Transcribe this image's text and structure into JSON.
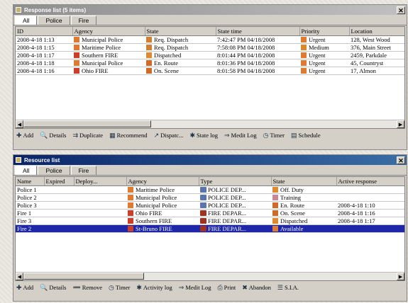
{
  "colors": {
    "urgent": "#e89040",
    "medium": "#d88a28",
    "blue_sel": "#1d27a8",
    "red": "#cc3d2a",
    "orange": "#e88a34",
    "green": "#3c7c3c",
    "pink": "#d08898",
    "available": "#e07a30"
  },
  "top_window": {
    "title": "Response list (5 items)",
    "tabs": [
      "All",
      "Police",
      "Fire"
    ],
    "columns": [
      "ID",
      "Agency",
      "State",
      "State time",
      "Priority",
      "Location"
    ],
    "rows": [
      {
        "id": "2008-4-18 1:13",
        "agency": "Municipal Police",
        "agency_color": "#e07a30",
        "state": "Req. Dispatch",
        "state_color": "#d08030",
        "time": "7:42:47 PM 04/18/2008",
        "priority": "Urgent",
        "priority_color": "#e07a30",
        "location": "128, West Wood"
      },
      {
        "id": "2008-4-18 1:15",
        "agency": "Maritime Police",
        "agency_color": "#e07a30",
        "state": "Req. Dispatch",
        "state_color": "#d08030",
        "time": "7:58:08 PM 04/18/2008",
        "priority": "Medium",
        "priority_color": "#d88a28",
        "location": "376, Main Street"
      },
      {
        "id": "2008-4-18 1:17",
        "agency": "Southern FIRE",
        "agency_color": "#cc3d2a",
        "state": "Dispatched",
        "state_color": "#e08a30",
        "time": "8:01:44 PM 04/18/2008",
        "priority": "Urgent",
        "priority_color": "#e07a30",
        "location": "2459, Parkdale"
      },
      {
        "id": "2008-4-18 1:18",
        "agency": "Municipal Police",
        "agency_color": "#e07a30",
        "state": "En. Route",
        "state_color": "#d06a28",
        "time": "8:01:36 PM 04/18/2008",
        "priority": "Urgent",
        "priority_color": "#e07a30",
        "location": "45, Countryst"
      },
      {
        "id": "2008-4-18 1:16",
        "agency": "Ohio FIRE",
        "agency_color": "#cc3d2a",
        "state": "On. Scene",
        "state_color": "#d06a28",
        "time": "8:01:58 PM 04/18/2008",
        "priority": "Urgent",
        "priority_color": "#e07a30",
        "location": "17, Almon"
      }
    ],
    "toolbar": [
      {
        "icon": "add-icon",
        "label": "Add"
      },
      {
        "icon": "details-icon",
        "label": "Details"
      },
      {
        "icon": "duplicate-icon",
        "label": "Duplicate"
      },
      {
        "icon": "recommend-icon",
        "label": "Recommend"
      },
      {
        "icon": "dispatch-icon",
        "label": "Dispatc..."
      },
      {
        "icon": "state-log-icon",
        "label": "State log"
      },
      {
        "icon": "medit-log-icon",
        "label": "Medit Log"
      },
      {
        "icon": "timer-icon",
        "label": "Timer"
      },
      {
        "icon": "schedule-icon",
        "label": "Schedule"
      }
    ]
  },
  "bottom_window": {
    "title": "Resource list",
    "tabs": [
      "All",
      "Police",
      "Fire"
    ],
    "columns": [
      "Name",
      "Expired",
      "Deploy...",
      "Agency",
      "Type",
      "State",
      "Active response"
    ],
    "rows": [
      {
        "name": "Police 1",
        "agency": "Maritime Police",
        "agency_color": "#e07a30",
        "type": "POLICE DEP...",
        "type_icon": "police-car-icon",
        "state": "Off. Duty",
        "state_color": "#e08a30",
        "active": ""
      },
      {
        "name": "Police 2",
        "agency": "Municipal Police",
        "agency_color": "#e07a30",
        "type": "POLICE DEP...",
        "type_icon": "police-car-icon",
        "state": "Training",
        "state_color": "#c88898",
        "active": ""
      },
      {
        "name": "Police 3",
        "agency": "Municipal Police",
        "agency_color": "#e07a30",
        "type": "POLICE DEP...",
        "type_icon": "police-car-icon",
        "state": "En. Route",
        "state_color": "#d06a28",
        "active": "2008-4-18 1:10"
      },
      {
        "name": "Fire 1",
        "agency": "Ohio FIRE",
        "agency_color": "#cc3d2a",
        "type": "FIRE DEPAR...",
        "type_icon": "fire-truck-icon",
        "state": "On. Scene",
        "state_color": "#d06a28",
        "active": "2008-4-18 1:16"
      },
      {
        "name": "Fire 3",
        "agency": "Southern FIRE",
        "agency_color": "#cc3d2a",
        "type": "FIRE DEPAR...",
        "type_icon": "fire-truck-icon",
        "state": "Dispatched",
        "state_color": "#e08a30",
        "active": "2008-4-18 1:17"
      },
      {
        "name": "Fire 2",
        "agency": "St-Bruno FIRE",
        "agency_color": "#cc3d2a",
        "type": "FIRE DEPAR...",
        "type_icon": "fire-truck-icon",
        "state": "Available",
        "state_color": "#e07a30",
        "active": "",
        "selected": true
      }
    ],
    "toolbar": [
      {
        "icon": "add-icon",
        "label": "Add"
      },
      {
        "icon": "details-icon",
        "label": "Details"
      },
      {
        "icon": "remove-icon",
        "label": "Remove"
      },
      {
        "icon": "timer-icon",
        "label": "Timer"
      },
      {
        "icon": "activity-log-icon",
        "label": "Activity log"
      },
      {
        "icon": "medit-log-icon",
        "label": "Medit Log"
      },
      {
        "icon": "print-icon",
        "label": "Print"
      },
      {
        "icon": "abandon-icon",
        "label": "Abandon"
      },
      {
        "icon": "sia-icon",
        "label": "S.I.A."
      }
    ]
  }
}
